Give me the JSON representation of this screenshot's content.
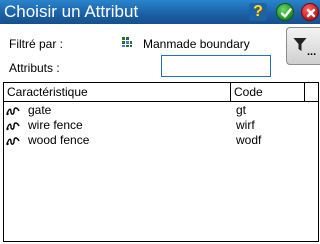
{
  "window": {
    "title": "Choisir un Attribut",
    "help_glyph": "?"
  },
  "filter": {
    "label": "Filtré par :",
    "value": "Manmade boundary",
    "icon": "layer-filter-icon",
    "button_suffix": "..."
  },
  "attributes": {
    "label": "Attributs :",
    "value": "",
    "placeholder": ""
  },
  "table": {
    "headers": [
      "Caractéristique",
      "Code"
    ],
    "rows": [
      {
        "name": "gate",
        "code": "gt",
        "icon": "line-feature-icon"
      },
      {
        "name": "wire fence",
        "code": "wirf",
        "icon": "line-feature-icon"
      },
      {
        "name": "wood fence",
        "code": "wodf",
        "icon": "line-feature-icon"
      }
    ]
  },
  "colors": {
    "titlebar": "#1b62a8",
    "input_border": "#1f6fc5"
  }
}
